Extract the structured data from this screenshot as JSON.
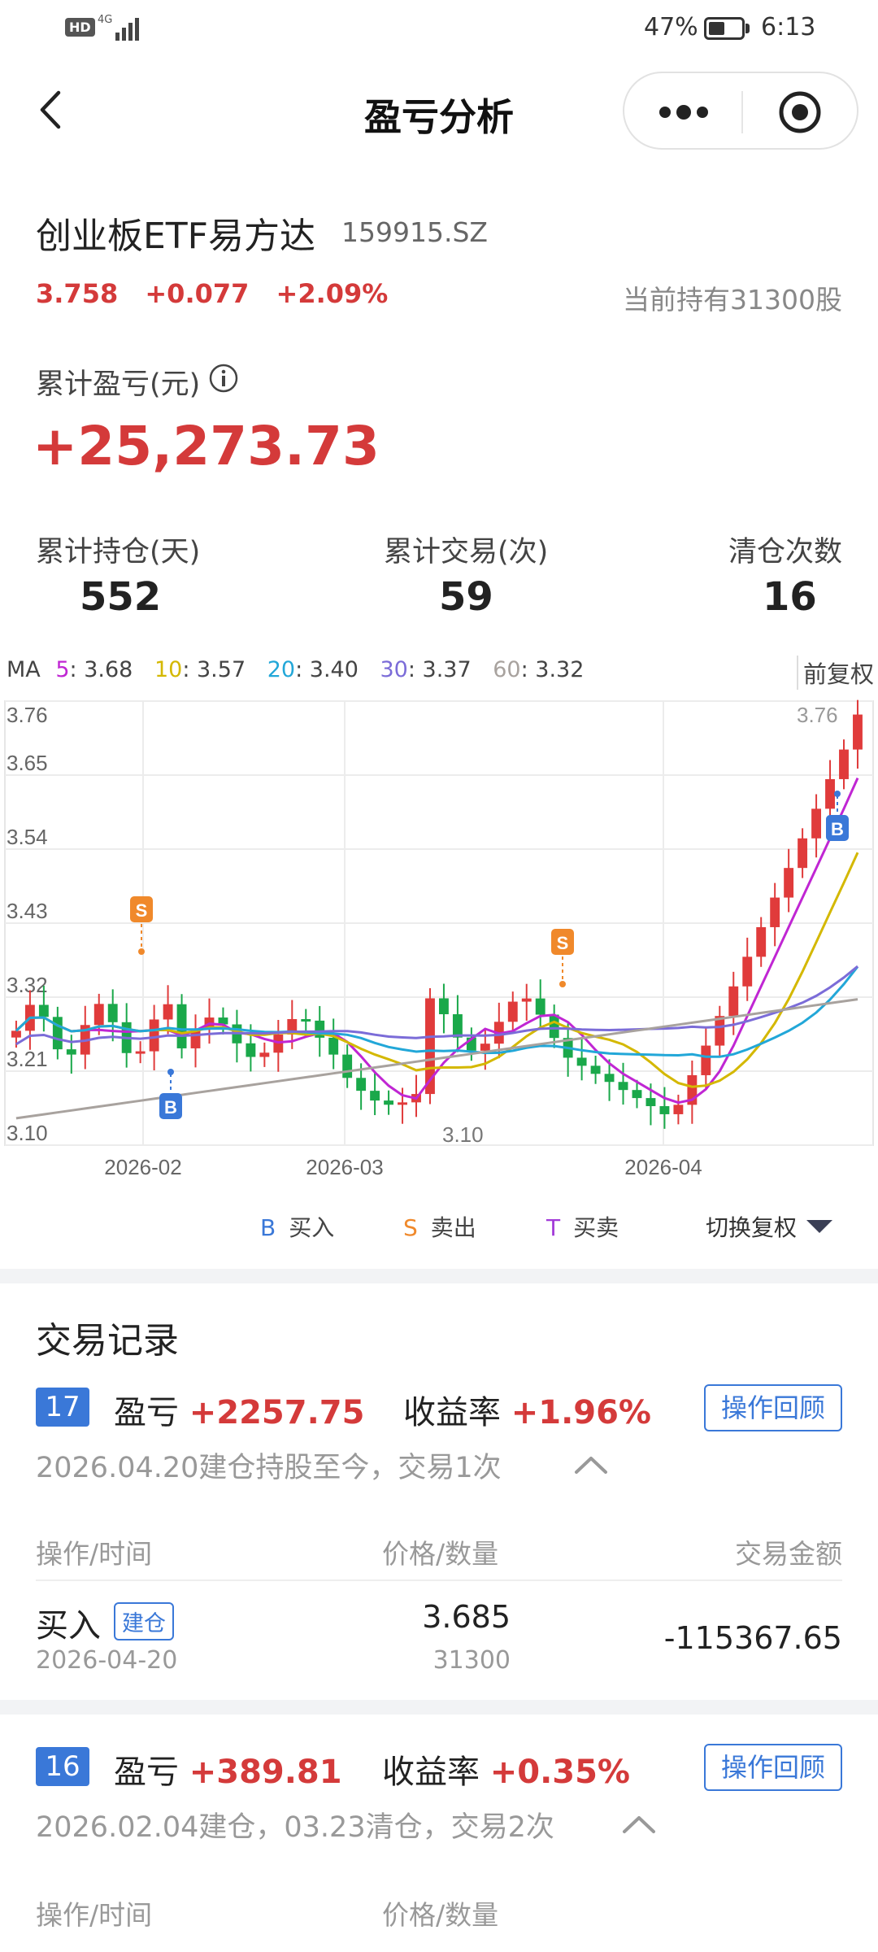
{
  "status_bar": {
    "hd": "HD",
    "network": "4G",
    "battery": "47%",
    "battery_level": 0.47,
    "time": "6:13"
  },
  "nav": {
    "title": "盈亏分析"
  },
  "stock": {
    "name": "创业板ETF易方达",
    "code": "159915.SZ",
    "price": "3.758",
    "change": "+0.077",
    "change_pct": "+2.09%",
    "holding": "当前持有31300股"
  },
  "pl": {
    "label": "累计盈亏(元)",
    "value": "+25,273.73"
  },
  "stats": [
    {
      "label": "累计持仓(天)",
      "value": "552"
    },
    {
      "label": "累计交易(次)",
      "value": "59"
    },
    {
      "label": "清仓次数",
      "value": "16"
    }
  ],
  "ma": {
    "label": "MA",
    "items": [
      {
        "key": "5",
        "value": "3.68",
        "color": "#c026d3"
      },
      {
        "key": "10",
        "value": "3.57",
        "color": "#d4b800"
      },
      {
        "key": "20",
        "value": "3.40",
        "color": "#22a7d8"
      },
      {
        "key": "30",
        "value": "3.37",
        "color": "#7b6cd8"
      },
      {
        "key": "60",
        "value": "3.32",
        "color": "#a8a29e"
      }
    ],
    "adjust_label": "前复权"
  },
  "chart_data": {
    "type": "candlestick",
    "y_ticks": [
      "3.76",
      "3.65",
      "3.54",
      "3.43",
      "3.32",
      "3.21",
      "3.10"
    ],
    "ylim": [
      3.1,
      3.76
    ],
    "x_ticks": [
      "2026-02",
      "2026-03",
      "2026-04"
    ],
    "max_label": "3.76",
    "min_label": "3.10",
    "up_color": "#e03b3b",
    "down_color": "#1aa84a",
    "markers": [
      {
        "type": "S",
        "color": "#f0892b"
      },
      {
        "type": "B",
        "color": "#3a78d8"
      },
      {
        "type": "S",
        "color": "#f0892b"
      },
      {
        "type": "B",
        "color": "#3a78d8"
      }
    ]
  },
  "legend": {
    "buy_key": "B",
    "buy": "买入",
    "sell_key": "S",
    "sell": "卖出",
    "trade_key": "T",
    "trade": "买卖",
    "switch": "切换复权"
  },
  "records": {
    "title": "交易记录",
    "items": [
      {
        "no": "17",
        "pl_label": "盈亏",
        "pl": "+2257.75",
        "rate_label": "收益率",
        "rate": "+1.96%",
        "review": "操作回顾",
        "summary": "2026.04.20建仓持股至今，交易1次"
      },
      {
        "no": "16",
        "pl_label": "盈亏",
        "pl": "+389.81",
        "rate_label": "收益率",
        "rate": "+0.35%",
        "review": "操作回顾",
        "summary": "2026.02.04建仓，03.23清仓，交易2次"
      }
    ],
    "table_header": {
      "op": "操作/时间",
      "price": "价格/数量",
      "amount": "交易金额"
    },
    "row": {
      "op": "买入",
      "tag": "建仓",
      "date": "2026-04-20",
      "price": "3.685",
      "qty": "31300",
      "amount": "-115367.65"
    }
  }
}
